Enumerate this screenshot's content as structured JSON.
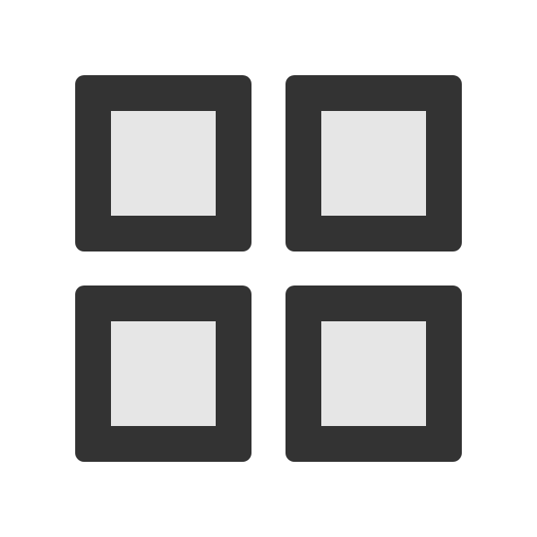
{
  "icon": {
    "name": "grid-view-icon",
    "frame_color": "#333333",
    "inner_color": "#e6e6e6",
    "background_color": "#ffffff"
  }
}
